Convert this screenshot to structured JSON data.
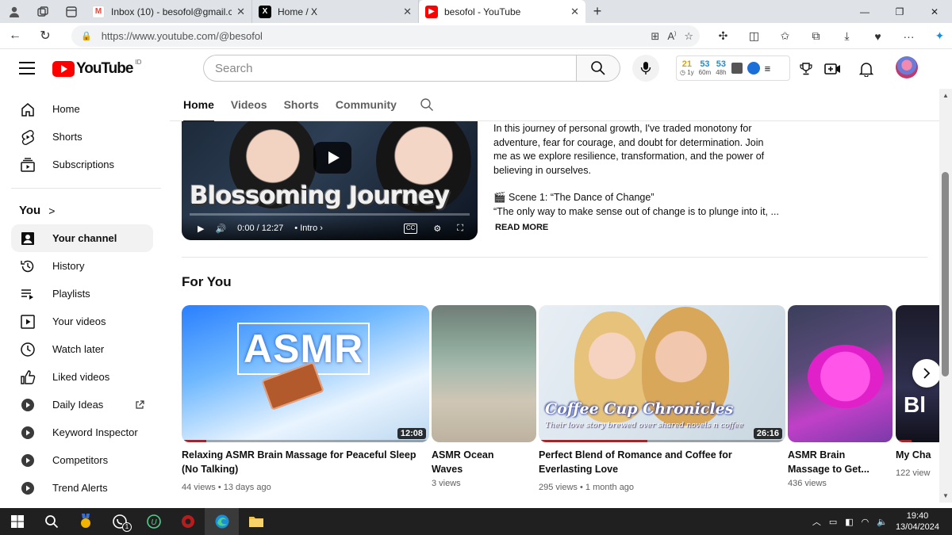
{
  "browser": {
    "tabs": [
      {
        "title": "Inbox (10) - besofol@gmail.com",
        "icon": "gmail-icon",
        "color": "#EA4335"
      },
      {
        "title": "Home / X",
        "icon": "x-icon",
        "color": "#000000"
      },
      {
        "title": "besofol - YouTube",
        "icon": "youtube-icon",
        "color": "#FF0000"
      }
    ],
    "url": "https://www.youtube.com/@besofol"
  },
  "header": {
    "logo_text": "YouTube",
    "country_code": "ID",
    "search_placeholder": "Search",
    "stats": [
      {
        "value": "21",
        "label": "1y",
        "color": "#d9a400"
      },
      {
        "value": "53",
        "label": "60m",
        "color": "#1a8fd8"
      },
      {
        "value": "53",
        "label": "48h",
        "color": "#1a8fd8"
      }
    ]
  },
  "sidebar": {
    "top": [
      {
        "label": "Home",
        "icon": "home-icon"
      },
      {
        "label": "Shorts",
        "icon": "shorts-icon"
      },
      {
        "label": "Subscriptions",
        "icon": "subscriptions-icon"
      }
    ],
    "you_label": "You",
    "you_items": [
      {
        "label": "Your channel",
        "icon": "your-channel-icon",
        "active": true
      },
      {
        "label": "History",
        "icon": "history-icon"
      },
      {
        "label": "Playlists",
        "icon": "playlists-icon"
      },
      {
        "label": "Your videos",
        "icon": "your-videos-icon"
      },
      {
        "label": "Watch later",
        "icon": "watch-later-icon"
      },
      {
        "label": "Liked videos",
        "icon": "liked-videos-icon"
      },
      {
        "label": "Daily Ideas",
        "icon": "vidiq-icon"
      },
      {
        "label": "Keyword Inspector",
        "icon": "vidiq-icon"
      },
      {
        "label": "Competitors",
        "icon": "vidiq-icon"
      },
      {
        "label": "Trend Alerts",
        "icon": "vidiq-icon"
      }
    ]
  },
  "channel_tabs": [
    "Home",
    "Videos",
    "Shorts",
    "Community"
  ],
  "featured": {
    "title_overlay": "Blossoming Journey",
    "time": "0:00 / 12:27",
    "chapter": "Intro",
    "description_p1": "In this journey of personal growth, I've traded monotony for adventure, fear for courage, and doubt for determination. Join me as we explore resilience, transformation, and the power of believing in ourselves.",
    "scene_line": "🎬 Scene 1: “The Dance of Change”",
    "quote_line": "“The only way to make sense out of change is to plunge into it, ...",
    "read_more": "READ MORE"
  },
  "for_you": {
    "heading": "For You",
    "videos": [
      {
        "title": "Relaxing ASMR Brain Massage for Peaceful Sleep (No Talking)",
        "views": "44 views",
        "age": "13 days ago",
        "duration": "12:08",
        "progress": 0.1,
        "thumb_text": "ASMR"
      },
      {
        "title": "ASMR Ocean Waves",
        "views": "3 views",
        "age": "",
        "duration": "",
        "progress": 0
      },
      {
        "title": "Perfect Blend of Romance and Coffee for Everlasting Love",
        "views": "295 views",
        "age": "1 month ago",
        "duration": "26:16",
        "progress": 0.44,
        "thumb_text": "Coffee Cup Chronicles",
        "thumb_sub": "Their love story brewed over shared novels n coffee"
      },
      {
        "title": "ASMR Brain Massage to Get...",
        "views": "436 views",
        "age": "",
        "duration": "",
        "progress": 0
      },
      {
        "title": "My Cha",
        "views": "122 view",
        "age": "",
        "duration": "",
        "progress": 0.15,
        "thumb_text": "Bl"
      }
    ]
  },
  "taskbar": {
    "time": "19:40",
    "date": "13/04/2024",
    "whatsapp_badge": "1"
  }
}
